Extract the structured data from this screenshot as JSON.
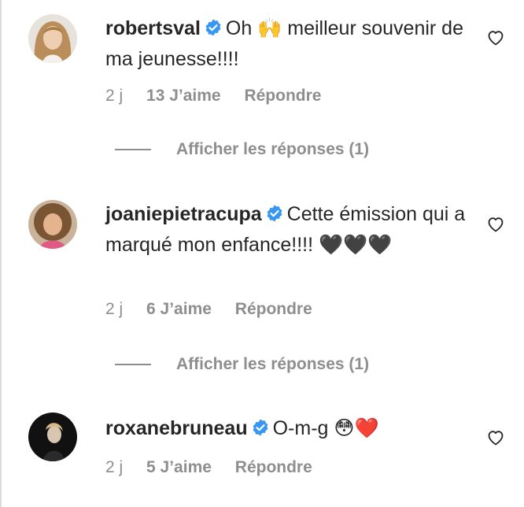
{
  "comments": [
    {
      "username": "robertsval",
      "text": "Oh 🙌 meilleur souvenir de ma jeunesse!!!!",
      "time": "2 j",
      "likes": "13 J’aime",
      "reply": "Répondre",
      "view_replies": "Afficher les réponses (1)"
    },
    {
      "username": "joaniepietracupa",
      "text": "Cette émission qui a marqué mon enfance!!!! 🖤🖤🖤",
      "time": "2 j",
      "likes": "6 J’aime",
      "reply": "Répondre",
      "view_replies": "Afficher les réponses (1)"
    },
    {
      "username": "roxanebruneau",
      "text": "O-m-g 😳❤️",
      "time": "2 j",
      "likes": "5 J’aime",
      "reply": "Répondre"
    }
  ],
  "icons": {
    "verified": "verified-badge-icon",
    "like": "heart-outline-icon"
  },
  "colors": {
    "verified": "#3897f0",
    "muted": "#8e8e8e",
    "text": "#262626"
  }
}
